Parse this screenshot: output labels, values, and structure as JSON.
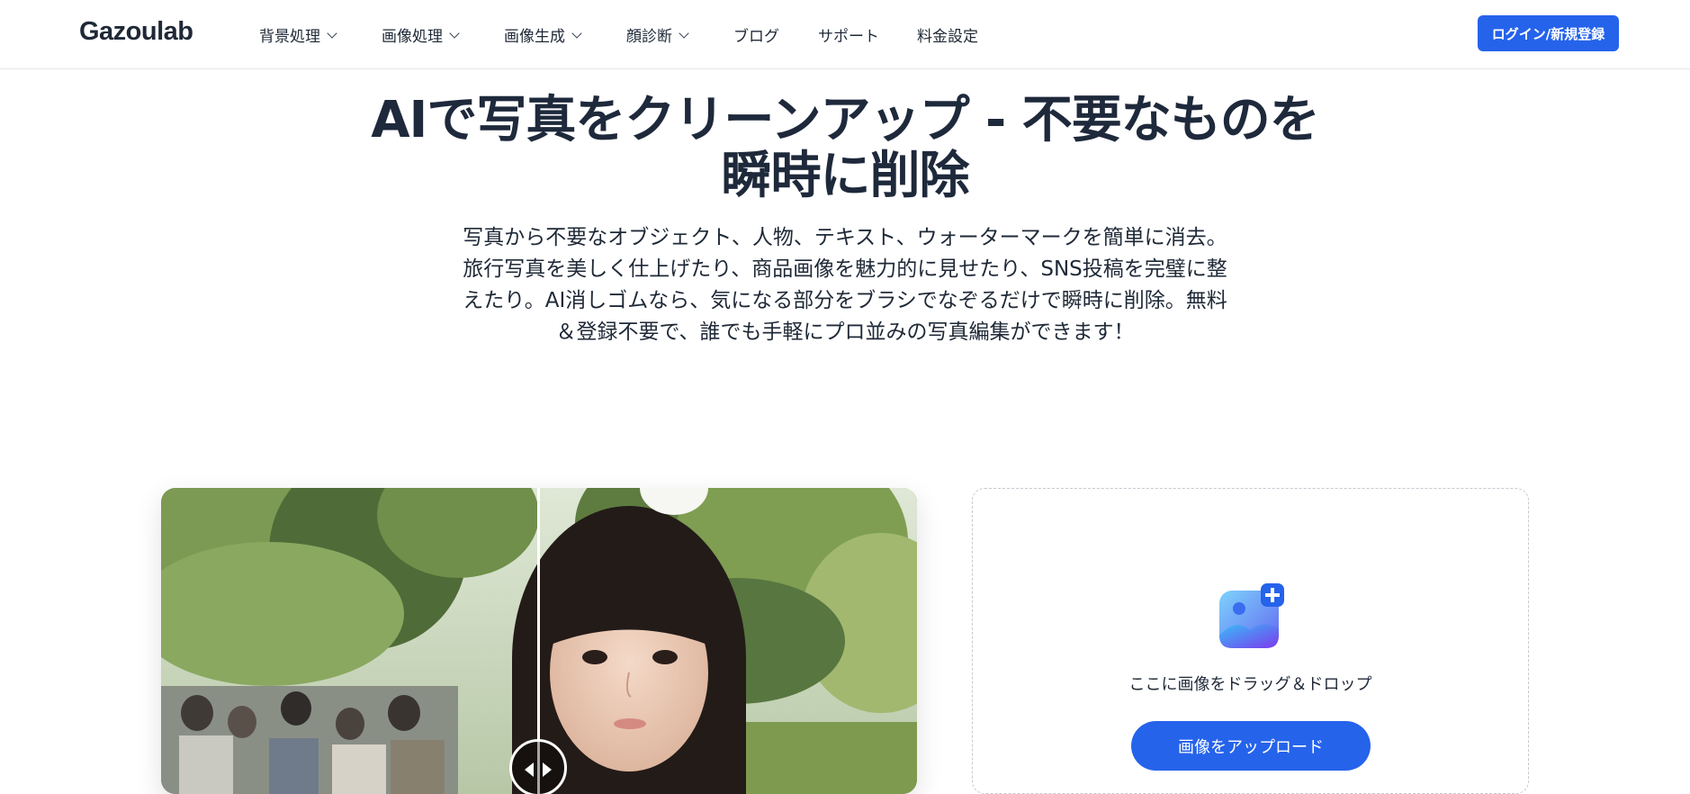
{
  "header": {
    "logo": "Gazoulab",
    "nav": [
      {
        "label": "背景処理",
        "has_dropdown": true
      },
      {
        "label": "画像処理",
        "has_dropdown": true
      },
      {
        "label": "画像生成",
        "has_dropdown": true
      },
      {
        "label": "顔診断",
        "has_dropdown": true
      },
      {
        "label": "ブログ",
        "has_dropdown": false
      },
      {
        "label": "サポート",
        "has_dropdown": false
      },
      {
        "label": "料金設定",
        "has_dropdown": false
      }
    ],
    "login_label": "ログイン/新規登録"
  },
  "hero": {
    "title_line1": "AIで写真をクリーンアップ - 不要なものを",
    "title_line2": "瞬時に削除",
    "description": "写真から不要なオブジェクト、人物、テキスト、ウォーターマークを簡単に消去。旅行写真を美しく仕上げたり、商品画像を魅力的に見せたり、SNS投稿を完璧に整えたり。AI消しゴムなら、気になる部分をブラシでなぞるだけで瞬時に削除。無料＆登録不要で、誰でも手軽にプロ並みの写真編集ができます！"
  },
  "upload": {
    "drop_text": "ここに画像をドラッグ＆ドロップ",
    "button_label": "画像をアップロード",
    "icon": "image-add-icon"
  },
  "colors": {
    "accent": "#2563eb",
    "text_dark": "#1e293b",
    "border": "#e5e7eb"
  }
}
